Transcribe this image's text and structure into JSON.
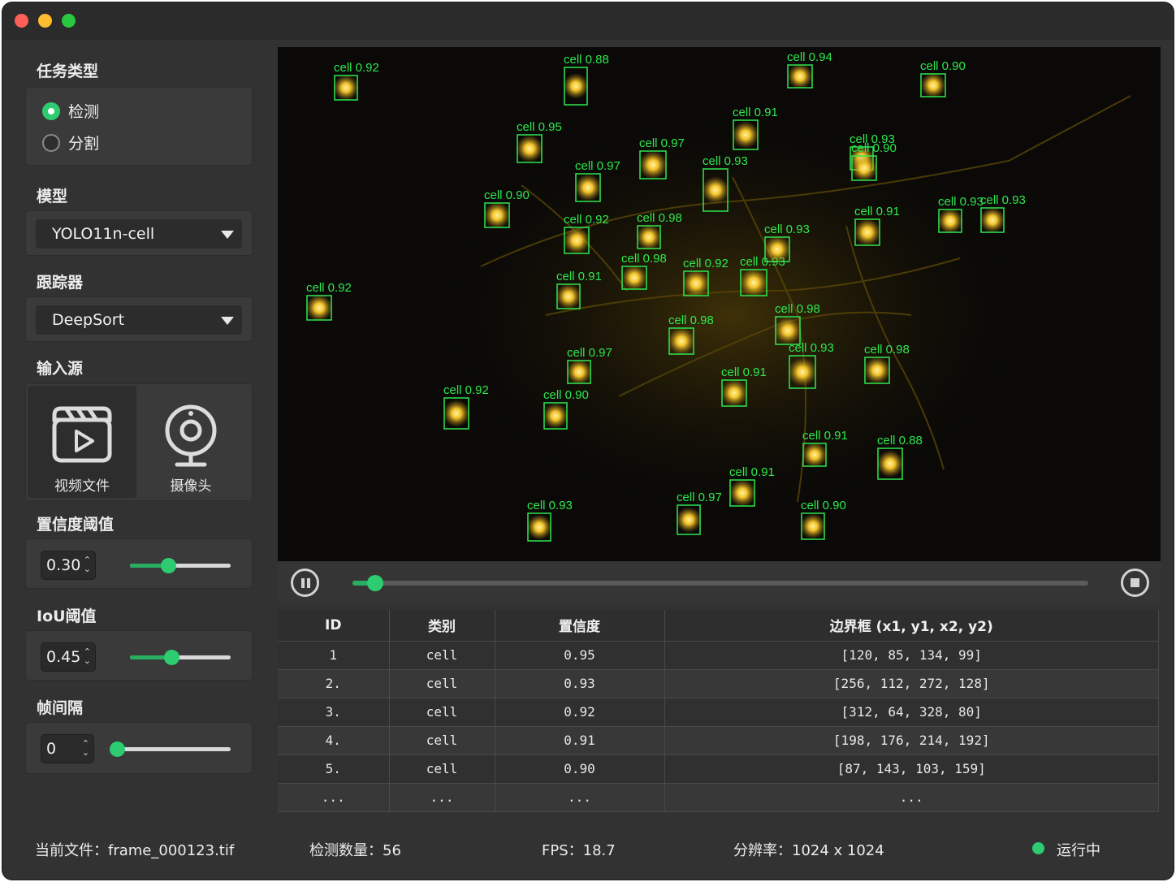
{
  "sidebar": {
    "task": {
      "label": "任务类型",
      "options": [
        {
          "label": "检测",
          "selected": true
        },
        {
          "label": "分割",
          "selected": false
        }
      ]
    },
    "model": {
      "label": "模型",
      "value": "YOLO11n-cell"
    },
    "tracker": {
      "label": "跟踪器",
      "value": "DeepSort"
    },
    "source": {
      "label": "输入源",
      "buttons": [
        {
          "label": "视频文件",
          "icon": "video-file-icon",
          "active": true
        },
        {
          "label": "摄像头",
          "icon": "webcam-icon",
          "active": false
        }
      ]
    },
    "confidence": {
      "label": "置信度阈值",
      "value": "0.30",
      "level": 0.38
    },
    "iou": {
      "label": "IoU阈值",
      "value": "0.45",
      "level": 0.41
    },
    "frame_interval": {
      "label": "帧间隔",
      "value": "0",
      "level": 0.0
    }
  },
  "player": {
    "progress": 0.03,
    "pause_icon": "pause-icon",
    "stop_icon": "stop-icon"
  },
  "video": {
    "detections": [
      {
        "label": "cell 0.92"
      },
      {
        "label": "cell 0.88"
      },
      {
        "label": "cell 0.94"
      },
      {
        "label": "cell 0.90"
      },
      {
        "label": "cell 0.91"
      },
      {
        "label": "cell 0.95"
      },
      {
        "label": "cell 0.93"
      },
      {
        "label": "cell 0.93"
      },
      {
        "label": "cell 0.90"
      },
      {
        "label": "cell 0.97"
      },
      {
        "label": "cell 0.97"
      },
      {
        "label": "cell 0.93"
      },
      {
        "label": "cell 0.90"
      },
      {
        "label": "cell 0.92"
      },
      {
        "label": "cell 0.93"
      },
      {
        "label": "cell 0.98"
      },
      {
        "label": "cell 0.91"
      },
      {
        "label": "cell 0.93"
      },
      {
        "label": "cell 0.92"
      },
      {
        "label": "cell 0.98"
      },
      {
        "label": "cell 0.92"
      },
      {
        "label": "cell 0.93"
      },
      {
        "label": "cell 0.91"
      },
      {
        "label": "cell 0.93"
      },
      {
        "label": "cell 0.98"
      },
      {
        "label": "cell 0.98"
      },
      {
        "label": "cell 0.97"
      },
      {
        "label": "cell 0.93"
      },
      {
        "label": "cell 0.98"
      },
      {
        "label": "cell 0.91"
      },
      {
        "label": "cell 0.92"
      },
      {
        "label": "cell 0.90"
      },
      {
        "label": "cell 0.91"
      },
      {
        "label": "cell 0.88"
      },
      {
        "label": "cell 0.91"
      },
      {
        "label": "cell 0.97"
      },
      {
        "label": "cell 0.93"
      },
      {
        "label": "cell 0.90"
      }
    ]
  },
  "table": {
    "headers": [
      "ID",
      "类别",
      "置信度",
      "边界框 (x1, y1, x2, y2)"
    ],
    "rows": [
      [
        "1",
        "cell",
        "0.95",
        "[120, 85, 134, 99]"
      ],
      [
        "2.",
        "cell",
        "0.93",
        "[256, 112, 272, 128]"
      ],
      [
        "3.",
        "cell",
        "0.92",
        "[312, 64, 328, 80]"
      ],
      [
        "4.",
        "cell",
        "0.91",
        "[198, 176, 214, 192]"
      ],
      [
        "5.",
        "cell",
        "0.90",
        "[87, 143, 103, 159]"
      ],
      [
        "...",
        "...",
        "...",
        "..."
      ]
    ]
  },
  "status": {
    "file": "当前文件：frame_000123.tif",
    "count": "检测数量：56",
    "fps": "FPS：18.7",
    "resolution": "分辨率：1024 x 1024",
    "state": "运行中",
    "state_color": "#2ecc71"
  },
  "colors": {
    "accent": "#2ecc71",
    "box": "#2ee84f",
    "cell": "#e0b020"
  }
}
